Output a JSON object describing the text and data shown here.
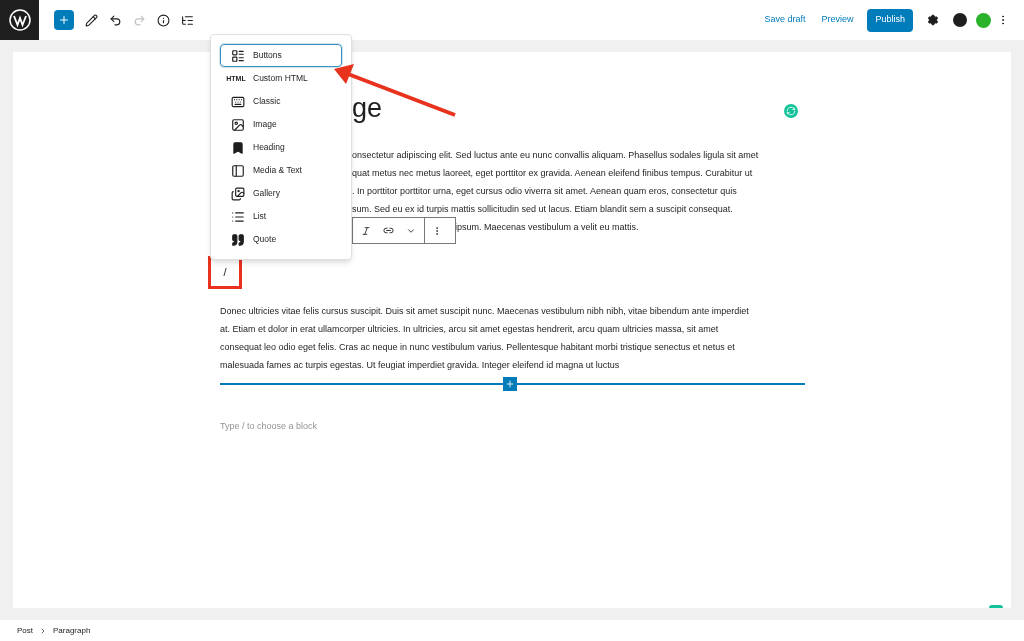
{
  "top_bar": {
    "links": [
      "Save draft",
      "Preview"
    ],
    "publish": "Publish"
  },
  "block_menu": {
    "items": [
      {
        "label": "Buttons",
        "kind": "buttons",
        "selected": true
      },
      {
        "label": "Custom HTML",
        "kind": "html",
        "icon_text": "HTML",
        "selected": false
      },
      {
        "label": "Classic",
        "kind": "classic",
        "selected": false
      },
      {
        "label": "Image",
        "kind": "image",
        "selected": false
      },
      {
        "label": "Heading",
        "kind": "heading",
        "selected": false
      },
      {
        "label": "Media & Text",
        "kind": "media",
        "selected": false
      },
      {
        "label": "Gallery",
        "kind": "gallery",
        "selected": false
      },
      {
        "label": "List",
        "kind": "list",
        "selected": false
      },
      {
        "label": "Quote",
        "kind": "quote",
        "selected": false
      }
    ]
  },
  "post": {
    "title_fragment": "ge",
    "paragraph_1_lines": [
      "onsectetur adipiscing elit. Sed luctus ante eu nunc convallis aliquam. Phasellus sodales ligula sit amet",
      "quat metus nec metus laoreet, eget porttitor ex gravida. Aenean eleifend finibus tempus. Curabitur ut",
      ". In porttitor porttitor urna, eget cursus odio viverra sit amet. Aenean quam eros, consectetur quis",
      "sum. Sed eu ex id turpis mattis sollicitudin sed ut lacus. Etiam blandit sem a suscipit consequat.",
      "ipsum. Maecenas vestibulum a velit eu mattis."
    ],
    "slash_input": "/",
    "paragraph_2_lines": [
      "Donec ultricies vitae felis cursus suscipit. Duis sit amet suscipit nunc. Maecenas vestibulum nibh nibh, vitae bibendum ante imperdiet",
      "at. Etiam et dolor in erat ullamcorper ultricies. In ultricies, arcu sit amet egestas hendrerit, arcu quam ultricies massa, sit amet",
      "consequat leo odio eget felis. Cras ac neque in nunc vestibulum varius. Pellentesque habitant morbi tristique senectus et netus et",
      "malesuada fames ac turpis egestas. Ut feugiat imperdiet gravida. Integer eleifend id magna ut luctus"
    ],
    "placeholder": "Type / to choose a block"
  },
  "breadcrumb": [
    "Post",
    "Paragraph"
  ]
}
